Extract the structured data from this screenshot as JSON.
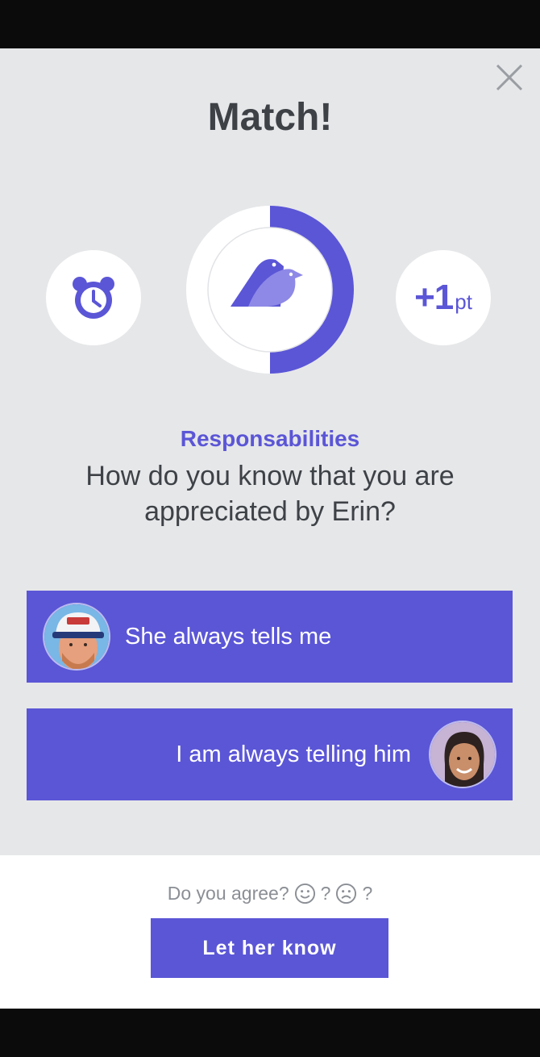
{
  "title": "Match!",
  "close_icon": "close-icon",
  "left_badge": {
    "icon": "alarm-clock-icon"
  },
  "progress": {
    "icon": "birds-icon",
    "fraction": 0.5,
    "accent": "#5b56d6"
  },
  "points": {
    "value": "+1",
    "unit": "pt"
  },
  "category": "Responsabilities",
  "question": "How do you know that you are appreciated by Erin?",
  "answers": [
    {
      "text": "She always tells me",
      "avatar": "man-with-cap-avatar"
    },
    {
      "text": "I am always telling him",
      "avatar": "woman-avatar"
    }
  ],
  "footer": {
    "prompt": "Do you agree?",
    "happy_icon": "smiley-icon",
    "sad_icon": "frowny-icon",
    "q1": "?",
    "q2": "?",
    "cta_label": "Let her know"
  },
  "colors": {
    "accent": "#5b56d6",
    "background": "#e6e7e9",
    "text": "#3e4247"
  }
}
